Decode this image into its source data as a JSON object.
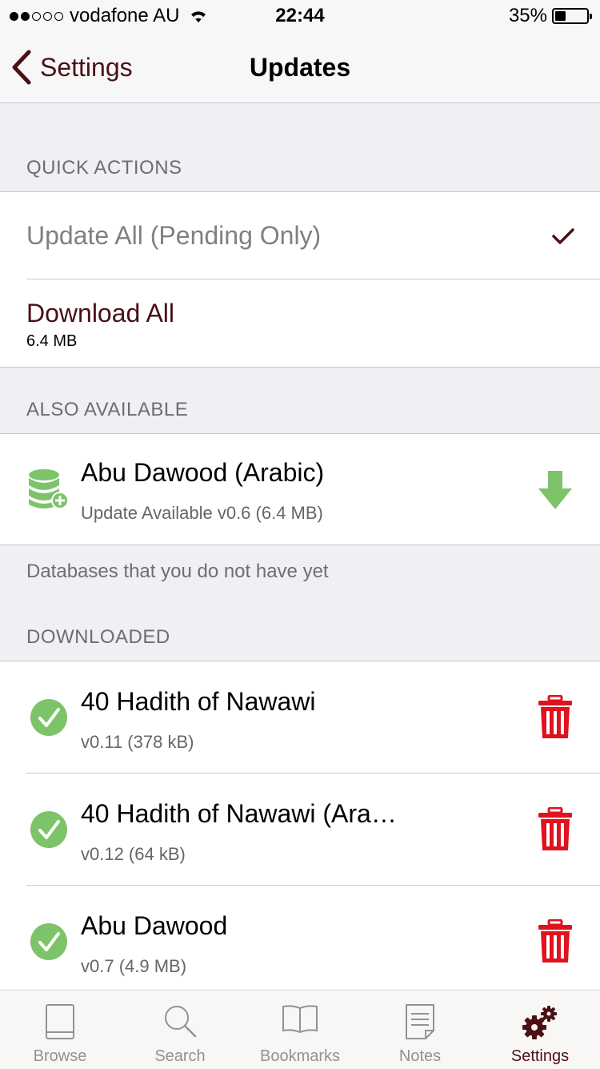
{
  "status": {
    "carrier": "vodafone AU",
    "time": "22:44",
    "battery": "35%",
    "battery_level": 0.35,
    "signal_bars": 2
  },
  "nav": {
    "back_label": "Settings",
    "title": "Updates"
  },
  "quick_actions": {
    "header": "QUICK ACTIONS",
    "update_all": "Update All (Pending Only)",
    "download_all": "Download All",
    "download_size": "6.4 MB"
  },
  "also_available": {
    "header": "ALSO AVAILABLE",
    "items": [
      {
        "title": "Abu Dawood (Arabic)",
        "subtitle": "Update Available v0.6 (6.4 MB)",
        "icon": "database-add-icon",
        "action_icon": "download-arrow-icon"
      }
    ],
    "footer": "Databases that you do not have yet"
  },
  "downloaded": {
    "header": "DOWNLOADED",
    "items": [
      {
        "title": "40 Hadith of Nawawi",
        "subtitle": "v0.11 (378 kB)"
      },
      {
        "title": "40 Hadith of Nawawi (Ara…",
        "subtitle": "v0.12 (64 kB)"
      },
      {
        "title": "Abu Dawood",
        "subtitle": "v0.7 (4.9 MB)"
      }
    ]
  },
  "tabs": [
    {
      "label": "Browse",
      "icon": "book-icon"
    },
    {
      "label": "Search",
      "icon": "magnifier-icon"
    },
    {
      "label": "Bookmarks",
      "icon": "open-book-icon"
    },
    {
      "label": "Notes",
      "icon": "note-icon"
    },
    {
      "label": "Settings",
      "icon": "gears-icon",
      "active": true
    }
  ],
  "colors": {
    "accent": "#4a1016",
    "green": "#7cc36a",
    "delete_red": "#e0121e",
    "background": "#efeff4"
  }
}
